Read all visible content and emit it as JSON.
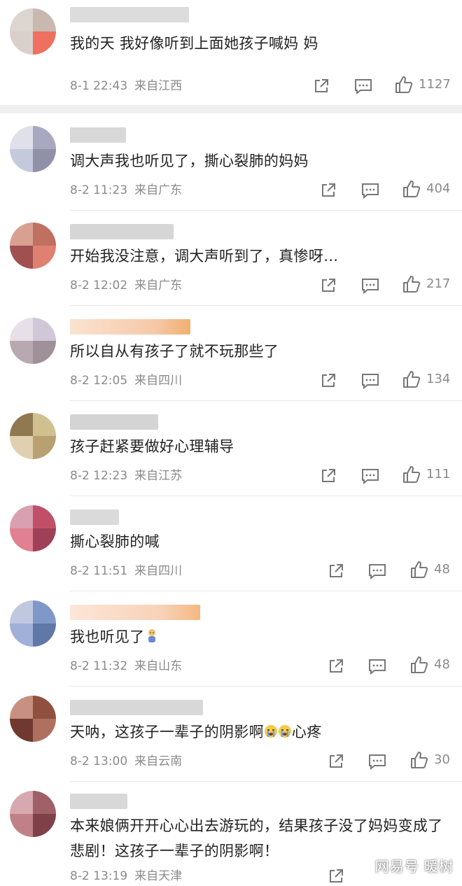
{
  "comments": [
    {
      "text": "我的天 我好像听到上面她孩子喊妈 妈",
      "date": "8-1 22:43",
      "location": "来自江西",
      "likes": "1127",
      "avatar_colors": [
        "#c8b8b0",
        "#f07060",
        "#d9d0cc",
        "#b0a0a0"
      ],
      "name_color": "#d0d0d0"
    },
    {
      "text": "调大声我也听见了，撕心裂肺的妈妈",
      "date": "8-2 11:23",
      "location": "来自广东",
      "likes": "404",
      "avatar_colors": [
        "#c5c9dc",
        "#a8a8c0",
        "#e0e0ea",
        "#9090a8"
      ],
      "name_color": "#cfcfcf"
    },
    {
      "text": "开始我没注意，调大声听到了，真惨呀…",
      "date": "8-2 12:02",
      "location": "来自广东",
      "likes": "217",
      "avatar_colors": [
        "#c07060",
        "#e08070",
        "#a05050",
        "#d8a090"
      ],
      "name_color": "#d2d2d2"
    },
    {
      "text": "所以自从有孩子了就不玩那些了",
      "date": "8-2 12:05",
      "location": "来自四川",
      "likes": "134",
      "avatar_colors": [
        "#d0c8d8",
        "#b8a8b0",
        "#e8e0e8",
        "#a09098"
      ],
      "name_color": "#f5c9a8"
    },
    {
      "text": "孩子赶紧要做好心理辅导",
      "date": "8-2 12:23",
      "location": "来自江苏",
      "likes": "111",
      "avatar_colors": [
        "#b8a070",
        "#d0c090",
        "#907850",
        "#e0d0b0"
      ],
      "name_color": "#cfcfcf"
    },
    {
      "text": "撕心裂肺的喊",
      "date": "8-2 11:51",
      "location": "来自四川",
      "likes": "48",
      "avatar_colors": [
        "#c05068",
        "#e08090",
        "#a04058",
        "#d8a0b0"
      ],
      "name_color": "#dcdcdc"
    },
    {
      "text": "我也听见了",
      "date": "8-2 11:32",
      "location": "来自山东",
      "likes": "48",
      "avatar_colors": [
        "#8098c8",
        "#a0b0d8",
        "#6078a8",
        "#c0c8e0"
      ],
      "name_color": "#f7d2b8"
    },
    {
      "text": "天呐，这孩子一辈子的阴影啊",
      "text_suffix": "心疼",
      "date": "8-2 13:00",
      "location": "来自云南",
      "likes": "30",
      "avatar_colors": [
        "#905040",
        "#b07060",
        "#703830",
        "#c89080"
      ],
      "name_color": "#d4d4d4"
    },
    {
      "text": "本来娘俩开开心心出去游玩的，结果孩子没了妈妈变成了悲剧！这孩子一辈子的阴影啊！",
      "date": "8-2 13:19",
      "location": "来自天津",
      "likes": "",
      "avatar_colors": [
        "#a06068",
        "#c08088",
        "#804048",
        "#d8a8b0"
      ],
      "name_color": "#d6d6d6"
    }
  ],
  "icons": {
    "share": "share-icon",
    "comment": "comment-icon",
    "like": "thumbs-up-icon"
  },
  "watermark": "网易号 暖树"
}
